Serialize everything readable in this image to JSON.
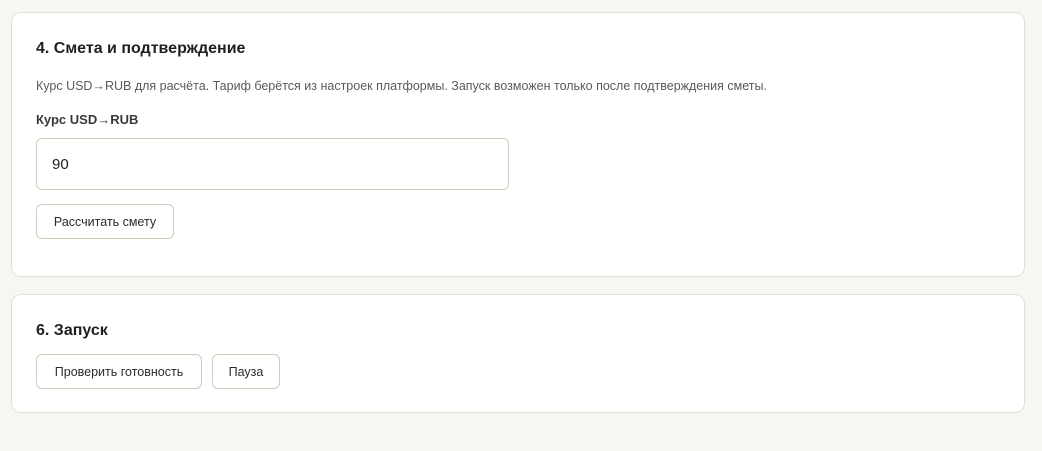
{
  "estimate": {
    "title": "4. Смета и подтверждение",
    "description": "Курс USD→RUB для расчёта. Тариф берётся из настроек платформы. Запуск возможен только после подтверждения сметы.",
    "rate_label": "Курс USD→RUB",
    "rate_value": "90",
    "calculate_button": "Рассчитать смету"
  },
  "launch": {
    "title": "6. Запуск",
    "check_button": "Проверить готовность",
    "pause_button": "Пауза"
  }
}
